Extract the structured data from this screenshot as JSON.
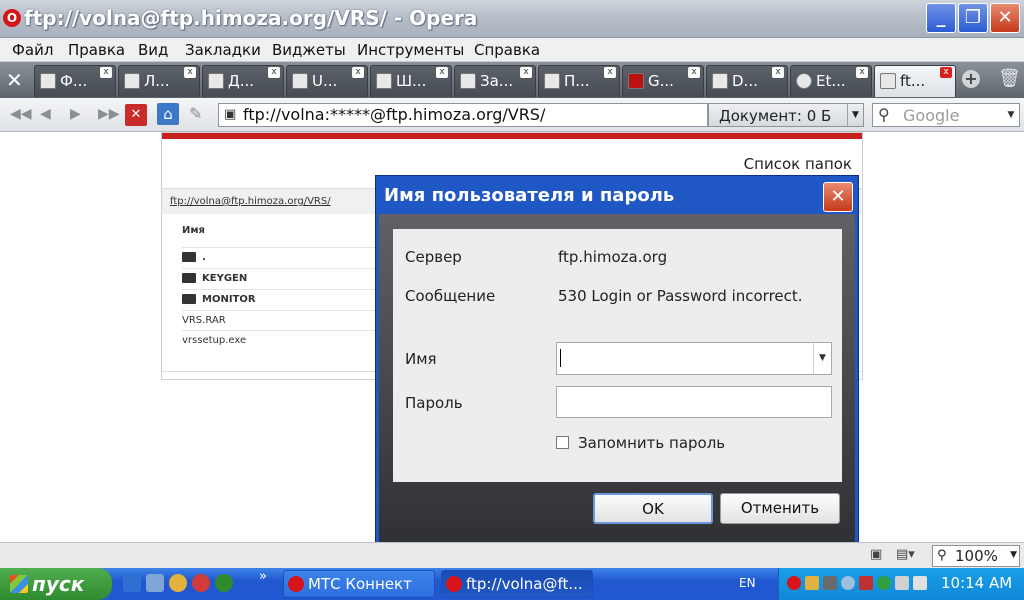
{
  "window": {
    "title": "ftp://volna@ftp.himoza.org/VRS/ - Opera",
    "app_icon": "O",
    "minimize": "_",
    "maximize": "❐",
    "close": "✕"
  },
  "menu": [
    "Файл",
    "Правка",
    "Вид",
    "Закладки",
    "Виджеты",
    "Инструменты",
    "Справка"
  ],
  "tabs": [
    {
      "label": "Ф...",
      "active": false
    },
    {
      "label": "Л...",
      "active": false
    },
    {
      "label": "Д...",
      "active": false
    },
    {
      "label": "U...",
      "active": false
    },
    {
      "label": "Ш...",
      "active": false
    },
    {
      "label": "За...",
      "active": false
    },
    {
      "label": "П...",
      "active": false
    },
    {
      "label": "G...",
      "active": false
    },
    {
      "label": "D...",
      "active": false
    },
    {
      "label": "Et...",
      "active": false
    },
    {
      "label": "ft...",
      "active": true
    }
  ],
  "tab_close": "x",
  "address": {
    "url": "ftp://volna:*****@ftp.himoza.org/VRS/",
    "doc_label": "Документ:    0 Б",
    "search_placeholder": "Google",
    "stop": "✕"
  },
  "page": {
    "heading": "Список папок",
    "breadcrumb": "ftp://volna@ftp.himoza.org/VRS/",
    "column_header": "Имя",
    "files": [
      {
        "name": ".",
        "type": "folder"
      },
      {
        "name": "KEYGEN",
        "type": "folder"
      },
      {
        "name": "MONITOR",
        "type": "folder"
      },
      {
        "name": "VRS.RAR",
        "type": "file"
      },
      {
        "name": "vrssetup.exe",
        "type": "file"
      }
    ]
  },
  "dialog": {
    "title": "Имя пользователя и пароль",
    "server_label": "Сервер",
    "server_value": "ftp.himoza.org",
    "message_label": "Сообщение",
    "message_value": "530 Login or Password incorrect.",
    "name_label": "Имя",
    "name_value": "",
    "password_label": "Пароль",
    "password_value": "",
    "remember_label": "Запомнить пароль",
    "remember_checked": false,
    "ok_label": "OK",
    "cancel_label": "Отменить",
    "close": "✕"
  },
  "status": {
    "zoom": "100%"
  },
  "taskbar": {
    "start_label": "пуск",
    "items": [
      {
        "label": "МТС Коннект",
        "active": false
      },
      {
        "label": "ftp://volna@ft...",
        "active": true
      }
    ],
    "quicklaunch_more": "»",
    "language": "EN",
    "clock": "10:14 AM"
  }
}
